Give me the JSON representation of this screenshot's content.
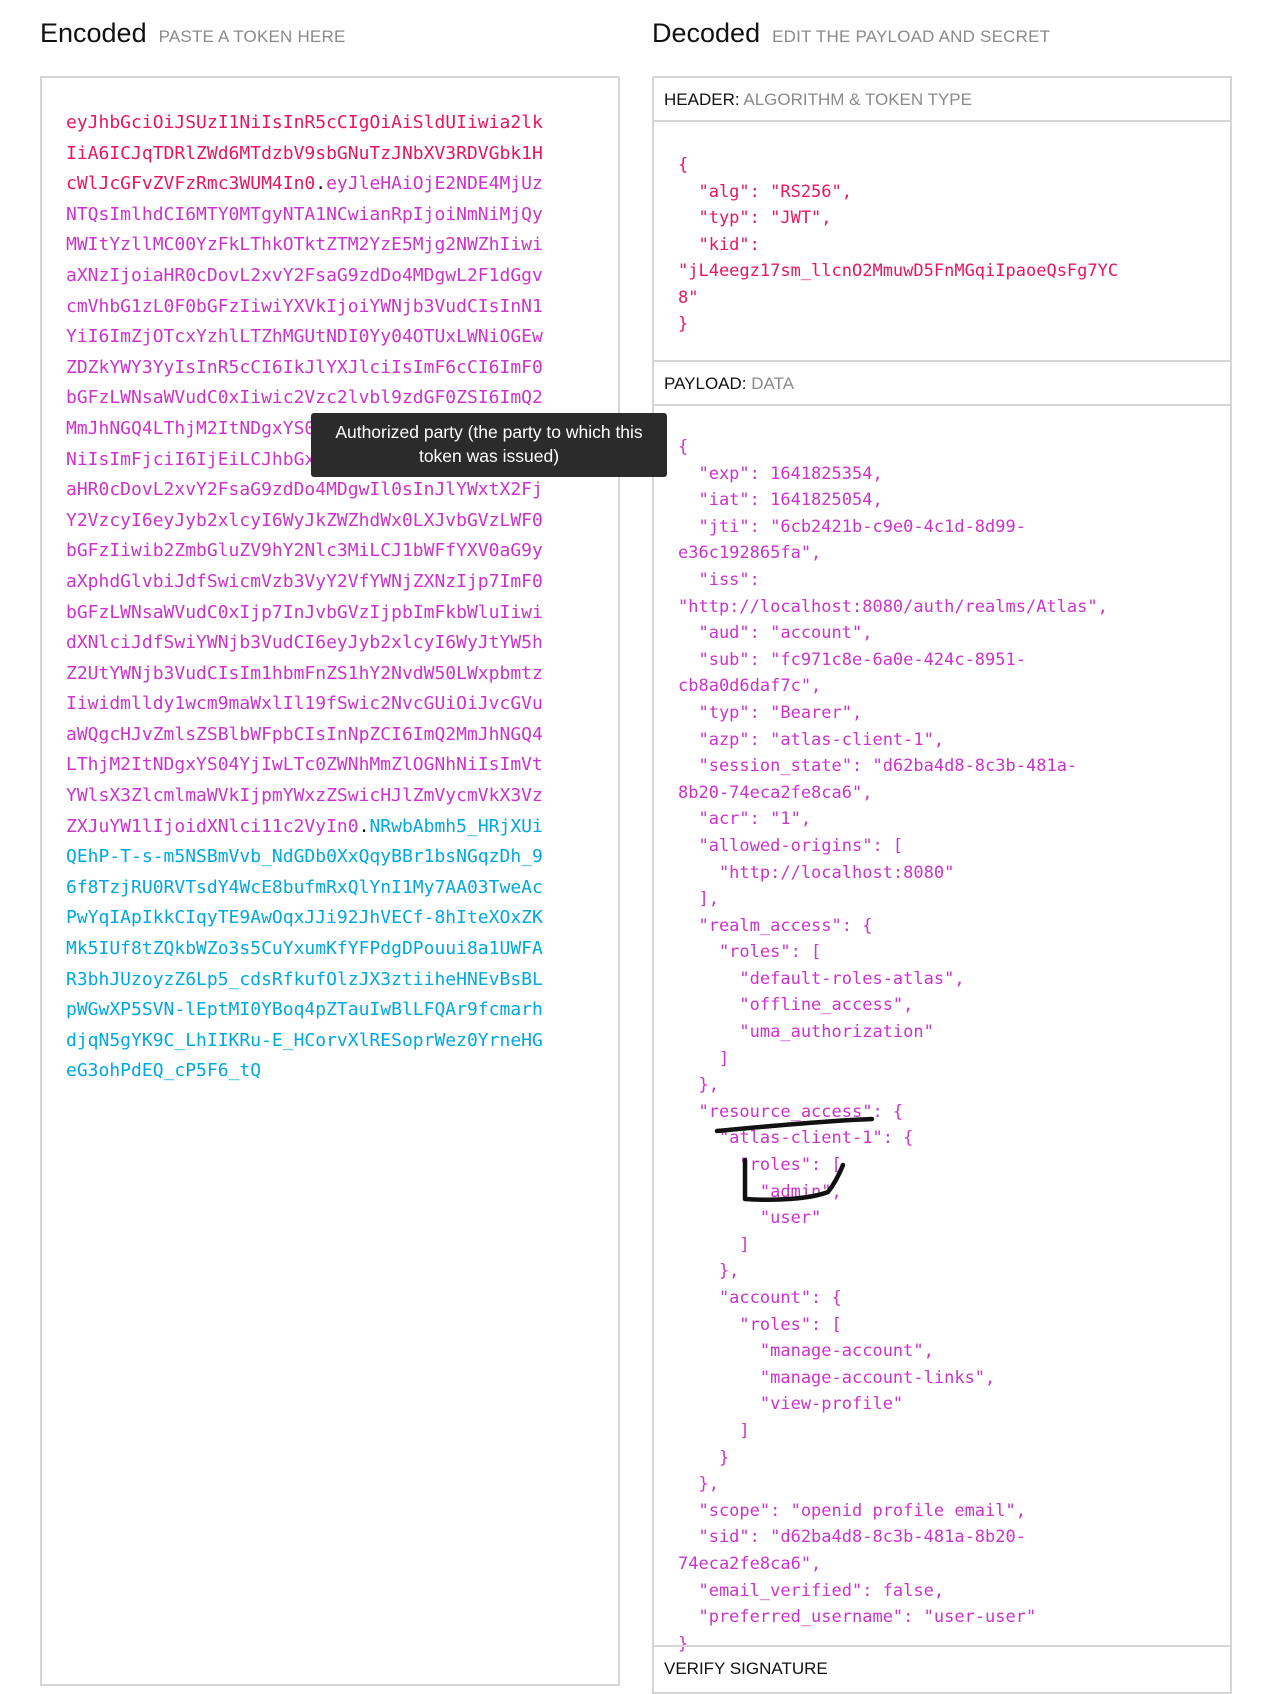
{
  "encoded": {
    "title": "Encoded",
    "subtitle": "PASTE A TOKEN HERE",
    "token": {
      "header": "eyJhbGciOiJSUzI1NiIsInR5cCIgOiAiSldUIiwia2lkIiA6ICJqTDRlZWd6MTdzbV9sbGNuTzJNbXV3RDVGbk1HcWlJcGFvZVFzRmc3WUM4In0",
      "payload": "eyJleHAiOjE2NDE4MjUzNTQsImlhdCI6MTY0MTgyNTA1NCwianRpIjoiNmNiMjQyMWItYzllMC00YzFkLThkOTktZTM2YzE5Mjg2NWZhIiwiaXNzIjoiaHR0cDovL2xvY2FsaG9zdDo4MDgwL2F1dGgvcmVhbG1zL0F0bGFzIiwiYXVkIjoiYWNjb3VudCIsInN1YiI6ImZjOTcxYzhlLTZhMGUtNDI0Yy04OTUxLWNiOGEwZDZkYWY3YyIsInR5cCI6IkJlYXJlciIsImF6cCI6ImF0bGFzLWNsaWVudC0xIiwic2Vzc2lvbl9zdGF0ZSI6ImQ2MmJhNGQ4LThjM2ItNDgxYS04YjIwLTc0ZWNhMmZlOGNhNiIsImFjciI6IjEiLCJhbGxvd2VkLW9yaWdpbnMiOlsiaHR0cDovL2xvY2FsaG9zdDo4MDgwIl0sInJlYWxtX2FjY2VzcyI6eyJyb2xlcyI6WyJkZWZhdWx0LXJvbGVzLWF0bGFzIiwib2ZmbGluZV9hY2Nlc3MiLCJ1bWFfYXV0aG9yaXphdGlvbiJdfSwicmVzb3VyY2VfYWNjZXNzIjp7ImF0bGFzLWNsaWVudC0xIjp7InJvbGVzIjpbImFkbWluIiwidXNlciJdfSwiYWNjb3VudCI6eyJyb2xlcyI6WyJtYW5hZ2UtYWNjb3VudCIsIm1hbmFnZS1hY2NvdW50LWxpbmtzIiwidmlldy1wcm9maWxlIl19fSwic2NvcGUiOiJvcGVuaWQgcHJvZmlsZSBlbWFpbCIsInNpZCI6ImQ2MmJhNGQ4LThjM2ItNDgxYS04YjIwLTc0ZWNhMmZlOGNhNiIsImVtYWlsX3ZlcmlmaWVkIjpmYWxzZSwicHJlZmVycmVkX3VzZXJuYW1lIjoidXNlci11c2VyIn0",
      "signature": "NRwbAbmh5_HRjXUiQEhP-T-s-m5NSBmVvb_NdGDb0XxQqyBBr1bsNGqzDh_96f8TzjRU0RVTsdY4WcE8bufmRxQlYnI1My7AA03TweAcPwYqIApIkkCIqyTE9AwOqxJJi92JhVECf-8hIteXOxZKMk5IUf8tZQkbWZo3s5CuYxumKfYFPdgDPouui8a1UWFAR3bhJUzoyzZ6Lp5_cdsRfkufOlzJX3ztiiheHNEvBsBLpWGwXP5SVN-lEptMI0YBoq4pZTauIwBlLFQAr9fcmarhdjqN5gYK9C_LhIIKRu-E_HCorvXlRESoprWez0YrneHGeG3ohPdEQ_cP5F6_tQ",
      "separator": "."
    }
  },
  "tooltip": {
    "line1": "Authorized party (the party to which this",
    "line2": "token was issued)"
  },
  "decoded": {
    "title": "Decoded",
    "subtitle": "EDIT THE PAYLOAD AND SECRET",
    "header_section": {
      "label": "HEADER:",
      "sublabel": "ALGORITHM & TOKEN TYPE",
      "json_text": "{\n  \"alg\": \"RS256\",\n  \"typ\": \"JWT\",\n  \"kid\":\n\"jL4eegz17sm_llcnO2MmuwD5FnMGqiIpaoeQsFg7YC\n8\"\n}"
    },
    "payload_section": {
      "label": "PAYLOAD:",
      "sublabel": "DATA",
      "json_text": "{\n  \"exp\": 1641825354,\n  \"iat\": 1641825054,\n  \"jti\": \"6cb2421b-c9e0-4c1d-8d99-\ne36c192865fa\",\n  \"iss\":\n\"http://localhost:8080/auth/realms/Atlas\",\n  \"aud\": \"account\",\n  \"sub\": \"fc971c8e-6a0e-424c-8951-\ncb8a0d6daf7c\",\n  \"typ\": \"Bearer\",\n  \"azp\": \"atlas-client-1\",\n  \"session_state\": \"d62ba4d8-8c3b-481a-\n8b20-74eca2fe8ca6\",\n  \"acr\": \"1\",\n  \"allowed-origins\": [\n    \"http://localhost:8080\"\n  ],\n  \"realm_access\": {\n    \"roles\": [\n      \"default-roles-atlas\",\n      \"offline_access\",\n      \"uma_authorization\"\n    ]\n  },\n  \"resource_access\": {\n    \"atlas-client-1\": {\n      \"roles\": [\n        \"admin\",\n        \"user\"\n      ]\n    },\n    \"account\": {\n      \"roles\": [\n        \"manage-account\",\n        \"manage-account-links\",\n        \"view-profile\"\n      ]\n    }\n  },\n  \"scope\": \"openid profile email\",\n  \"sid\": \"d62ba4d8-8c3b-481a-8b20-\n74eca2fe8ca6\",\n  \"email_verified\": false,\n  \"preferred_username\": \"user-user\"\n}"
    },
    "verify_section": {
      "label": "VERIFY SIGNATURE"
    }
  },
  "colors": {
    "header": "#e8175d",
    "payload": "#cc33cc",
    "signature": "#00a8e0",
    "border": "#d6d6d6",
    "tooltip_bg": "#2b2b2b",
    "annotation_ink": "#111111"
  }
}
